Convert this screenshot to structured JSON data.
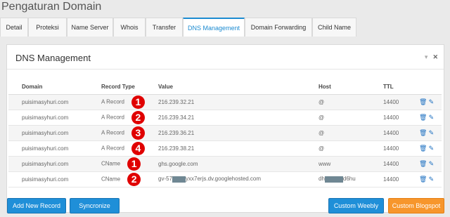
{
  "page_title": "Pengaturan Domain",
  "tabs": [
    {
      "label": "Detail",
      "active": false
    },
    {
      "label": "Proteksi",
      "active": false
    },
    {
      "label": "Name Server",
      "active": false
    },
    {
      "label": "Whois",
      "active": false
    },
    {
      "label": "Transfer",
      "active": false
    },
    {
      "label": "DNS Management",
      "active": true
    },
    {
      "label": "Domain Forwarding",
      "active": false
    },
    {
      "label": "Child Name",
      "active": false
    }
  ],
  "panel": {
    "title": "DNS Management",
    "collapse_icon": "chevron-down",
    "close_icon": "close"
  },
  "table": {
    "headers": [
      "Domain",
      "Record Type",
      "Value",
      "Host",
      "TTL"
    ],
    "rows": [
      {
        "domain": "puisimasyhuri.com",
        "type": "A Record",
        "badge": "1",
        "value": "216.239.32.21",
        "host": "@",
        "ttl": "14400"
      },
      {
        "domain": "puisimasyhuri.com",
        "type": "A Record",
        "badge": "2",
        "value": "216.239.34.21",
        "host": "@",
        "ttl": "14400"
      },
      {
        "domain": "puisimasyhuri.com",
        "type": "A Record",
        "badge": "3",
        "value": "216.239.36.21",
        "host": "@",
        "ttl": "14400"
      },
      {
        "domain": "puisimasyhuri.com",
        "type": "A Record",
        "badge": "4",
        "value": "216.239.38.21",
        "host": "@",
        "ttl": "14400"
      },
      {
        "domain": "puisimasyhuri.com",
        "type": "CName",
        "badge": "1",
        "value": "ghs.google.com",
        "host": "www",
        "ttl": "14400"
      },
      {
        "domain": "puisimasyhuri.com",
        "type": "CName",
        "badge": "2",
        "value_prefix": "gv-57",
        "value_suffix": "yxx7erjs.dv.googlehosted.com",
        "host_prefix": "dh",
        "host_suffix": "d6hu",
        "ttl": "14400"
      }
    ],
    "action_icons": [
      "trash-icon",
      "pencil-icon"
    ]
  },
  "buttons": {
    "add": "Add New Record",
    "sync": "Syncronize",
    "weebly": "Custom Weebly",
    "blogspot": "Custom Blogspot"
  },
  "colors": {
    "accent": "#1f8fd8",
    "badge": "#e00000",
    "orange": "#f7962c"
  }
}
